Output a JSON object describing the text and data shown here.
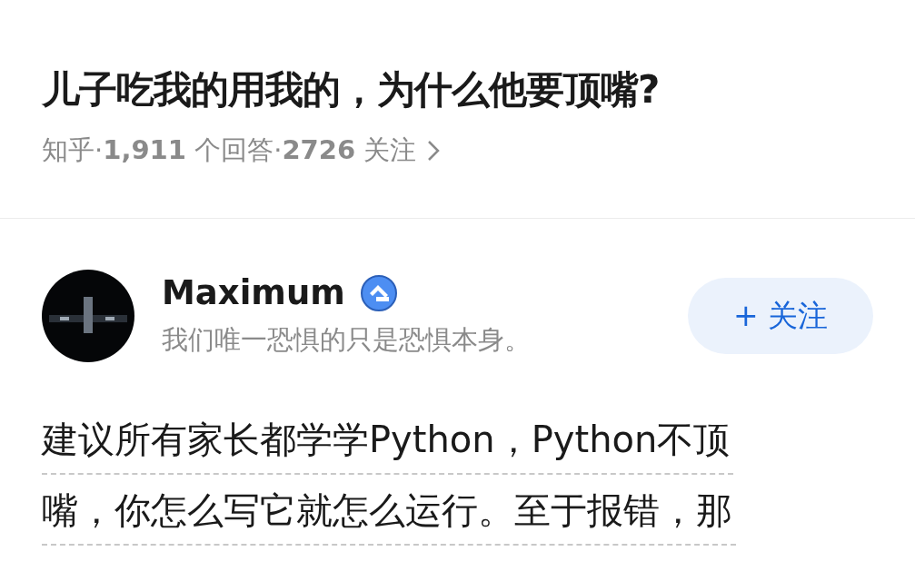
{
  "question": {
    "title": "儿子吃我的用我的，为什么他要顶嘴?",
    "meta": "知乎·**1,911** 个回答·**2726** 关注"
  },
  "author": {
    "name": "Maximum",
    "bio": "我们唯一恐惧的只是恐惧本身。",
    "follow_button": "+ 关注"
  },
  "answer": {
    "lines": [
      "建议所有家长都学学Python，Python不顶",
      "嘴，你怎么写它就怎么运行。至于报错，那"
    ]
  }
}
